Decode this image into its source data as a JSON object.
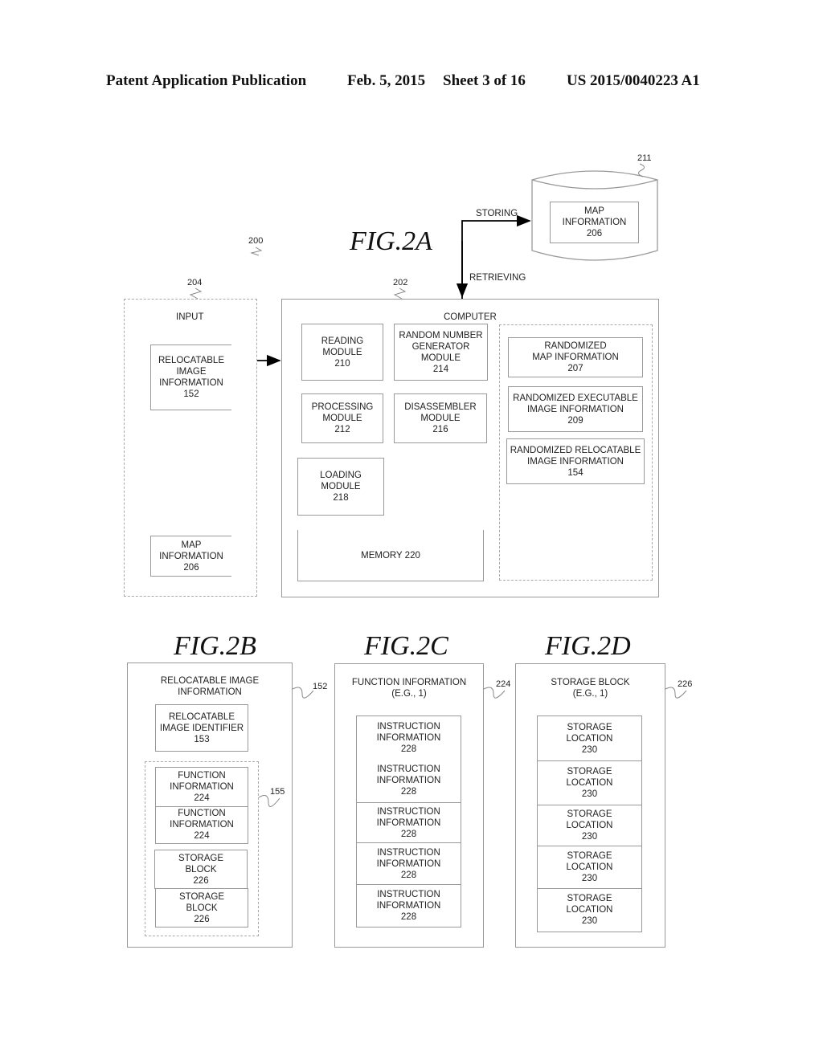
{
  "header": {
    "publication": "Patent Application Publication",
    "date": "Feb. 5, 2015",
    "sheet": "Sheet 3 of 16",
    "number": "US 2015/0040223 A1"
  },
  "fig2a": {
    "title": "FIG.2A",
    "ref_system": "200",
    "ref_input": "204",
    "ref_computer": "202",
    "ref_storage": "211",
    "arrow_storing": "STORING",
    "arrow_retrieving": "RETRIEVING",
    "storage": {
      "map_lines": [
        "MAP",
        "INFORMATION",
        "206"
      ]
    },
    "input": {
      "title": "INPUT",
      "relocatable": [
        "RELOCATABLE",
        "IMAGE",
        "INFORMATION",
        "152"
      ],
      "map": [
        "MAP",
        "INFORMATION",
        "206"
      ]
    },
    "computer": {
      "title": "COMPUTER",
      "reading": [
        "READING",
        "MODULE",
        "210"
      ],
      "rng": [
        "RANDOM NUMBER",
        "GENERATOR",
        "MODULE",
        "214"
      ],
      "processing": [
        "PROCESSING",
        "MODULE",
        "212"
      ],
      "disassembler": [
        "DISASSEMBLER",
        "MODULE",
        "216"
      ],
      "loading": [
        "LOADING",
        "MODULE",
        "218"
      ],
      "memory": "MEMORY 220",
      "randomized_map": [
        "RANDOMIZED",
        "MAP INFORMATION",
        "207"
      ],
      "randomized_exec": [
        "RANDOMIZED EXECUTABLE",
        "IMAGE INFORMATION",
        "209"
      ],
      "randomized_reloc": [
        "RANDOMIZED RELOCATABLE",
        "IMAGE INFORMATION",
        "154"
      ]
    }
  },
  "fig2b": {
    "title": "FIG.2B",
    "ref": "152",
    "ref_group": "155",
    "heading": [
      "RELOCATABLE IMAGE",
      "INFORMATION"
    ],
    "identifier": [
      "RELOCATABLE",
      "IMAGE IDENTIFIER",
      "153"
    ],
    "function_items": [
      [
        "FUNCTION",
        "INFORMATION",
        "224"
      ],
      [
        "FUNCTION",
        "INFORMATION",
        "224"
      ]
    ],
    "storage_items": [
      [
        "STORAGE",
        "BLOCK",
        "226"
      ],
      [
        "STORAGE",
        "BLOCK",
        "226"
      ]
    ]
  },
  "fig2c": {
    "title": "FIG.2C",
    "ref": "224",
    "heading": [
      "FUNCTION INFORMATION",
      "(E.G., 1)"
    ],
    "items": [
      [
        "INSTRUCTION",
        "INFORMATION",
        "228"
      ],
      [
        "INSTRUCTION",
        "INFORMATION",
        "228"
      ],
      [
        "INSTRUCTION",
        "INFORMATION",
        "228"
      ],
      [
        "INSTRUCTION",
        "INFORMATION",
        "228"
      ],
      [
        "INSTRUCTION",
        "INFORMATION",
        "228"
      ]
    ]
  },
  "fig2d": {
    "title": "FIG.2D",
    "ref": "226",
    "heading": [
      "STORAGE BLOCK",
      "(E.G., 1)"
    ],
    "items": [
      [
        "STORAGE",
        "LOCATION",
        "230"
      ],
      [
        "STORAGE",
        "LOCATION",
        "230"
      ],
      [
        "STORAGE",
        "LOCATION",
        "230"
      ],
      [
        "STORAGE",
        "LOCATION",
        "230"
      ],
      [
        "STORAGE",
        "LOCATION",
        "230"
      ]
    ]
  }
}
